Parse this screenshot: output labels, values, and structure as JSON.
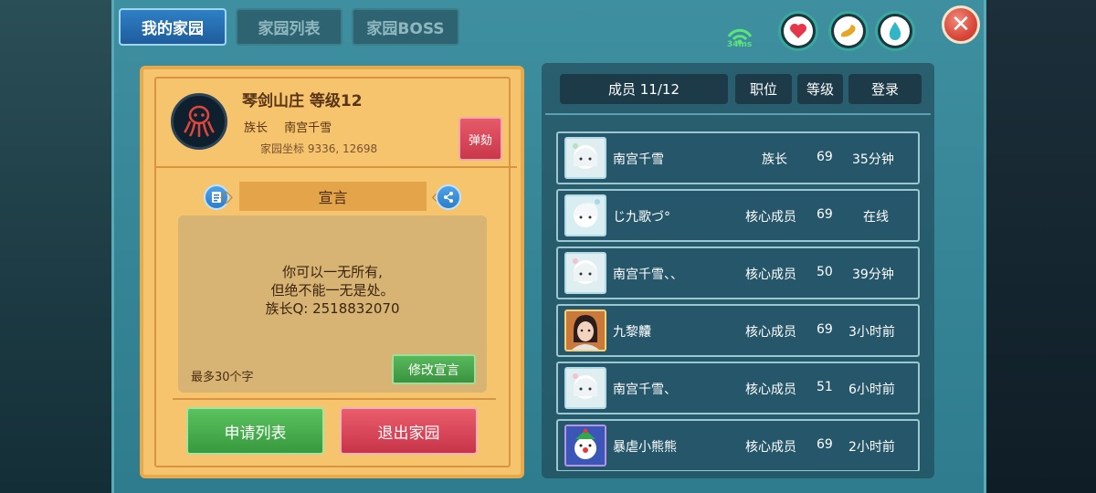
{
  "tabs": [
    {
      "label": "我的家园",
      "active": true
    },
    {
      "label": "家园列表",
      "active": false
    },
    {
      "label": "家园BOSS",
      "active": false
    }
  ],
  "status": {
    "ping": "34ms",
    "orbs": [
      {
        "icon": "heart-icon",
        "color": "#e5374b"
      },
      {
        "icon": "food-icon",
        "color": "#e6a627"
      },
      {
        "icon": "water-drop-icon",
        "color": "#2fb6c9"
      }
    ]
  },
  "home": {
    "name_line": "琴剑山庄 等级12",
    "leader_label": "族长",
    "leader_name": "南宫千雪",
    "coords": "家园坐标 9336, 12698",
    "impeach_label": "弹劾",
    "declaration_title": "宣言",
    "declaration_lines": [
      "你可以一无所有,",
      "但绝不能一无是处。",
      "族长Q: 2518832070"
    ],
    "declaration_hint": "最多30个字",
    "edit_label": "修改宣言",
    "apply_list_label": "申请列表",
    "leave_label": "退出家园"
  },
  "members": {
    "header": {
      "members": "成员 11/12",
      "position": "职位",
      "level": "等级",
      "login": "登录"
    },
    "rows": [
      {
        "name": "南宫千雪",
        "position": "族长",
        "level": "69",
        "login": "35分钟",
        "avatar": "white-hair"
      },
      {
        "name": "じ九歌づ°",
        "position": "核心成员",
        "level": "69",
        "login": "在线",
        "avatar": "white-hair-2"
      },
      {
        "name": "南宫千雪、、",
        "position": "核心成员",
        "level": "50",
        "login": "39分钟",
        "avatar": "white-hair"
      },
      {
        "name": "九黎齉",
        "position": "核心成员",
        "level": "69",
        "login": "3小时前",
        "avatar": "dark-hair"
      },
      {
        "name": "南宫千雪、",
        "position": "核心成员",
        "level": "51",
        "login": "6小时前",
        "avatar": "white-hair"
      },
      {
        "name": "暴虐小熊熊",
        "position": "核心成员",
        "level": "69",
        "login": "2小时前",
        "avatar": "clown"
      }
    ]
  }
}
